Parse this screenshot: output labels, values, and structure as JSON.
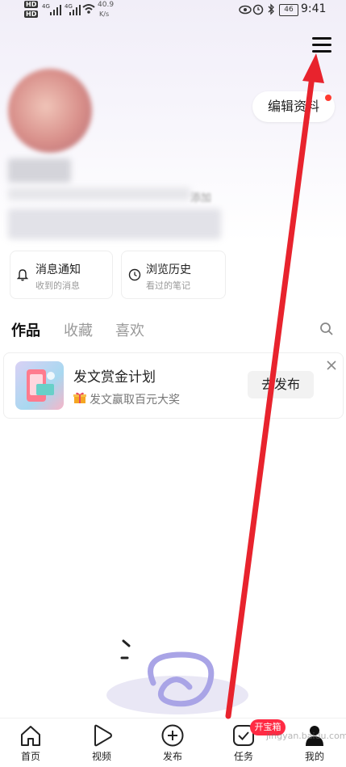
{
  "status": {
    "signal1": "HD",
    "signal2": "HD",
    "net": "4G",
    "speed_value": "40.9",
    "speed_unit": "K/s",
    "battery": "46",
    "time": "9:41"
  },
  "header": {
    "edit_profile_label": "编辑资料"
  },
  "profile": {
    "add_text": "添加"
  },
  "cards": [
    {
      "title": "消息通知",
      "subtitle": "收到的消息",
      "icon": "bell-icon"
    },
    {
      "title": "浏览历史",
      "subtitle": "看过的笔记",
      "icon": "clock-icon"
    }
  ],
  "tabs": [
    {
      "label": "作品",
      "active": true
    },
    {
      "label": "收藏",
      "active": false
    },
    {
      "label": "喜欢",
      "active": false
    }
  ],
  "promo": {
    "title": "发文赏金计划",
    "subtitle": "发文赢取百元大奖",
    "button": "去发布"
  },
  "bottom_nav": [
    {
      "label": "首页",
      "icon": "home-icon"
    },
    {
      "label": "视频",
      "icon": "play-icon"
    },
    {
      "label": "发布",
      "icon": "plus-circle-icon"
    },
    {
      "label": "任务",
      "icon": "check-square-icon"
    },
    {
      "label": "我的",
      "icon": "user-icon"
    }
  ],
  "task_badge": "开宝箱",
  "watermark_text": "jingyan.baidu.com",
  "colors": {
    "accent": "#ff2a43",
    "arrow": "#e8232d"
  }
}
